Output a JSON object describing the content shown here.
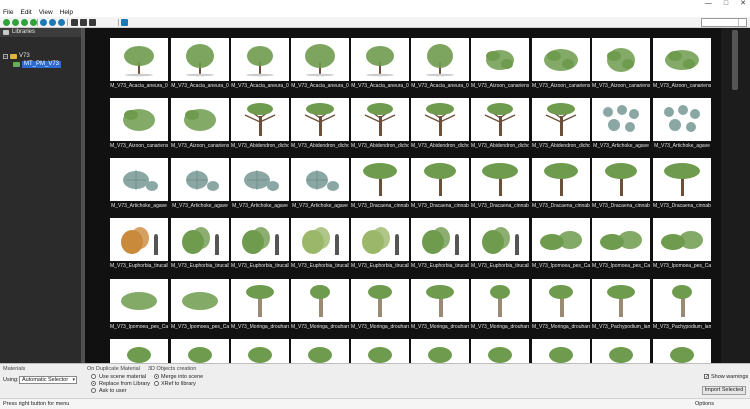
{
  "menu": [
    "File",
    "Edit",
    "View",
    "Help"
  ],
  "window_buttons": [
    "—",
    "□",
    "✕"
  ],
  "toolbar": {
    "icons": [
      {
        "name": "back-icon",
        "color": "#2fa33a"
      },
      {
        "name": "forward-icon",
        "color": "#2fa33a"
      },
      {
        "name": "up-icon",
        "color": "#2fa33a"
      },
      {
        "name": "refresh-icon",
        "color": "#2fa33a"
      },
      {
        "name": "home-icon",
        "color": "#1d7ab8"
      },
      {
        "name": "folder-icon",
        "color": "#1d7ab8"
      },
      {
        "name": "favorite-icon",
        "color": "#1d7ab8"
      },
      {
        "name": "zoom-in-icon",
        "color": "#3a3a3a"
      },
      {
        "name": "zoom-out-icon",
        "color": "#3a3a3a"
      },
      {
        "name": "view-icon",
        "color": "#3a3a3a"
      },
      {
        "name": "info-icon",
        "color": "#1d7ab8"
      }
    ],
    "search_value": ""
  },
  "left_panel": {
    "header": "Libraries",
    "tree": [
      {
        "label": "V73",
        "selected": false
      },
      {
        "label": "MT_PM_V73",
        "selected": true
      }
    ]
  },
  "gallery": {
    "rows": [
      {
        "kind": "tree-round",
        "captions": [
          "M_V73_Acacia_aneura_0",
          "M_V73_Acacia_aneura_0",
          "M_V73_Acacia_aneura_0",
          "M_V73_Acacia_aneura_0",
          "M_V73_Acacia_aneura_0",
          "M_V73_Acacia_aneura_0",
          "M_V73_Aizoon_canariense",
          "M_V73_Aizoon_canariense",
          "M_V73_Aizoon_canariense",
          "M_V73_Aizoon_canariense"
        ]
      },
      {
        "kind": "dragon",
        "captions": [
          "M_V73_Aizoon_canariense",
          "M_V73_Aizoon_canariense",
          "M_V73_Abidendron_dichotom",
          "M_V73_Abidendron_dichotom",
          "M_V73_Abidendron_dichotom",
          "M_V73_Abidendron_dichotom",
          "M_V73_Abidendron_dichotom",
          "M_V73_Abidendron_dichotom",
          "M_V73_Artichoke_agave",
          "M_V73_Artichoke_agave"
        ]
      },
      {
        "kind": "agave",
        "captions": [
          "M_V73_Artichoke_agave",
          "M_V73_Artichoke_agave",
          "M_V73_Artichoke_agave",
          "M_V73_Artichoke_agave",
          "M_V73_Dracaena_cinnabari",
          "M_V73_Dracaena_cinnabari",
          "M_V73_Dracaena_cinnabari",
          "M_V73_Dracaena_cinnabari",
          "M_V73_Dracaena_cinnabari",
          "M_V73_Dracaena_cinnabari"
        ]
      },
      {
        "kind": "shrub",
        "captions": [
          "M_V73_Euphorbia_tirucalli",
          "M_V73_Euphorbia_tirucalli",
          "M_V73_Euphorbia_tirucalli",
          "M_V73_Euphorbia_tirucalli",
          "M_V73_Euphorbia_tirucalli",
          "M_V73_Euphorbia_tirucalli",
          "M_V73_Euphorbia_tirucalli",
          "M_V73_Ipomoea_pes_Caprae",
          "M_V73_Ipomoea_pes_Caprae",
          "M_V73_Ipomoea_pes_Caprae"
        ]
      },
      {
        "kind": "moringa",
        "captions": [
          "M_V73_Ipomoea_pes_Caprae",
          "M_V73_Ipomoea_pes_Caprae",
          "M_V73_Moringa_drouhardii",
          "M_V73_Moringa_drouhardii",
          "M_V73_Moringa_drouhardii",
          "M_V73_Moringa_drouhardii",
          "M_V73_Moringa_drouhardii",
          "M_V73_Moringa_drouhardii",
          "M_V73_Pachypodium_lamerei",
          "M_V73_Pachypodium_lamerei"
        ]
      },
      {
        "kind": "partial",
        "captions": [
          "",
          "",
          "",
          "",
          "",
          "",
          "",
          "",
          "",
          ""
        ]
      }
    ]
  },
  "bottom": {
    "materials_group": "Materials",
    "using_label": "Using:",
    "using_value": "Automatic Selector",
    "duplicate_group": "On Duplicate Material",
    "duplicate_options": [
      "Use scene material",
      "Replace from Library",
      "Ask to user"
    ],
    "duplicate_selected": 1,
    "objects_group": "3D Objects creation",
    "objects_options": [
      "Merge into scene",
      "XRef to library"
    ],
    "objects_selected": 0,
    "show_warnings": "Show warnings",
    "import_button": "Import Selected"
  },
  "status": {
    "left": "Press right button for menu",
    "right": "Options"
  },
  "colors": {
    "tree_selected": "#2e6bd1",
    "foliage": "#6f9b4e",
    "trunk": "#6b4f3a",
    "agave": "#8aa7a4",
    "autumn": "#c98a3c"
  }
}
